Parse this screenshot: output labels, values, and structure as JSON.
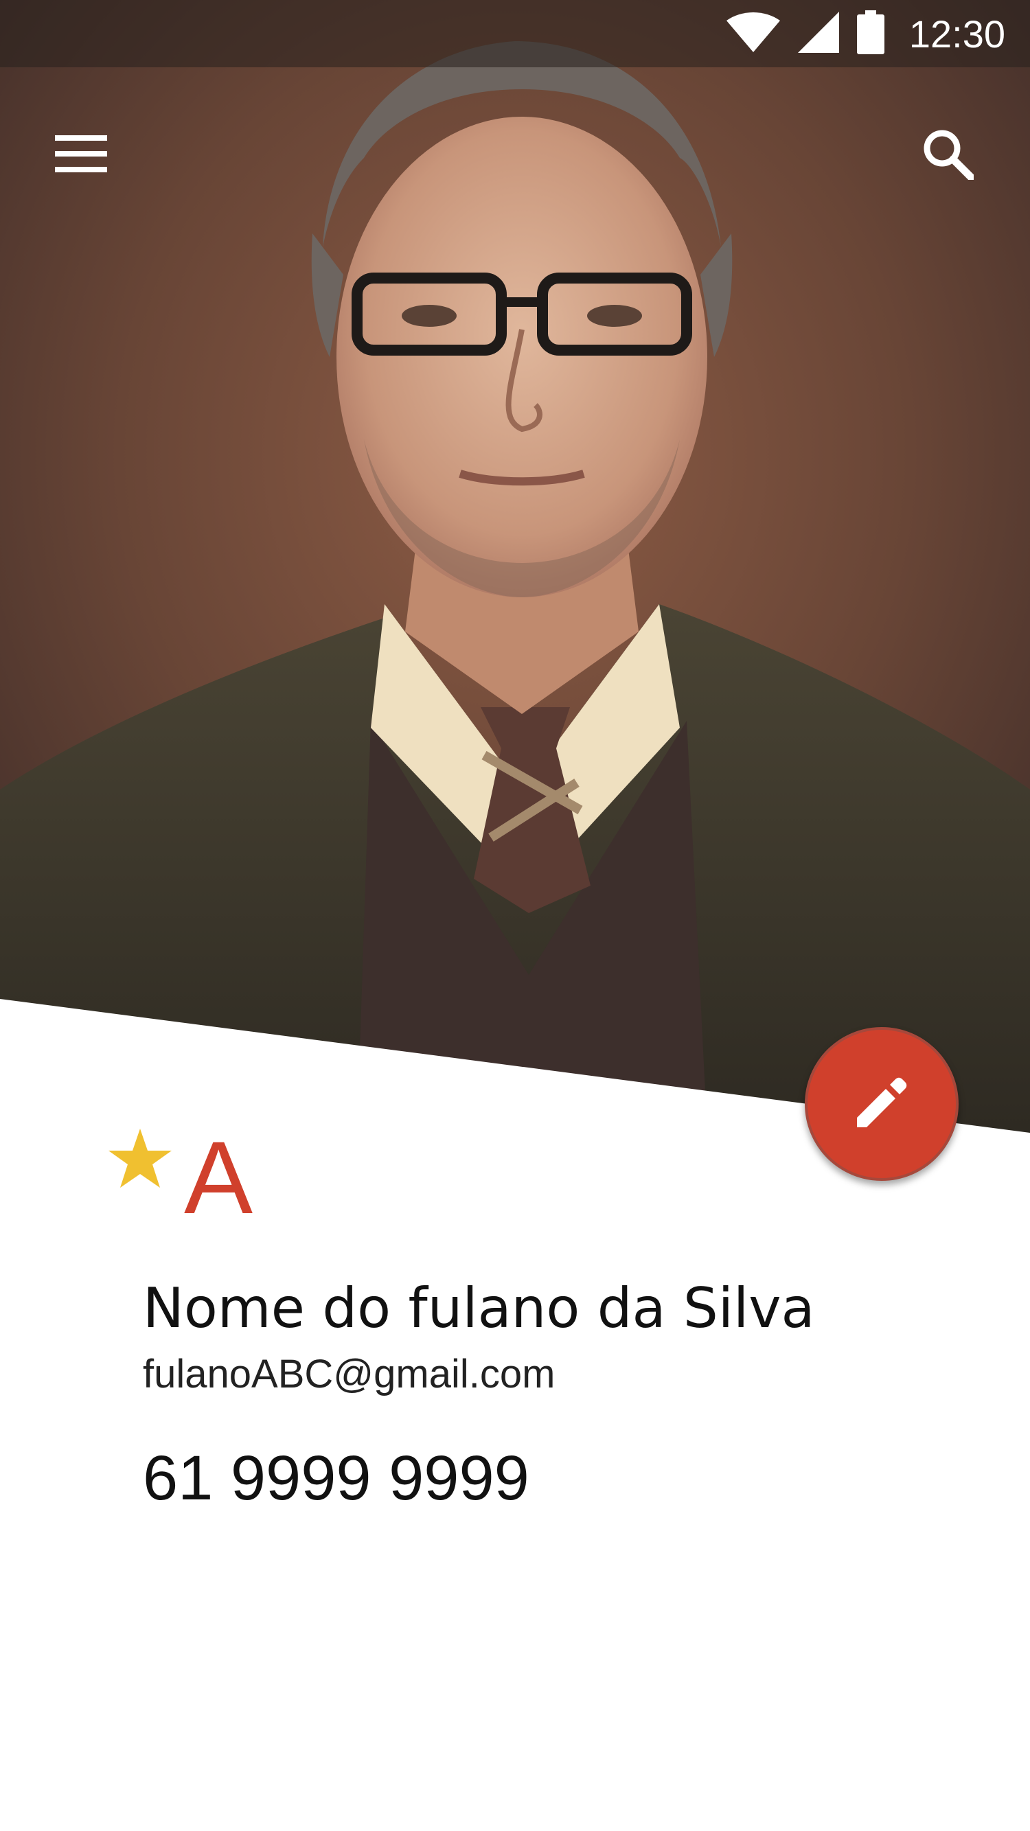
{
  "status_bar": {
    "time": "12:30",
    "icons": [
      "wifi-icon",
      "cell-signal-icon",
      "battery-icon"
    ]
  },
  "app_bar": {
    "menu_icon": "hamburger-menu-icon",
    "search_icon": "search-icon"
  },
  "contact": {
    "starred": true,
    "index_letter": "A",
    "name": "Nome do fulano da Silva",
    "email": "fulanoABC@gmail.com",
    "phone": "61 9999 9999"
  },
  "fab": {
    "icon": "pencil-edit-icon"
  },
  "colors": {
    "accent": "#d0402c",
    "star": "#f0c030",
    "status_bar_tint": "#28201e"
  }
}
